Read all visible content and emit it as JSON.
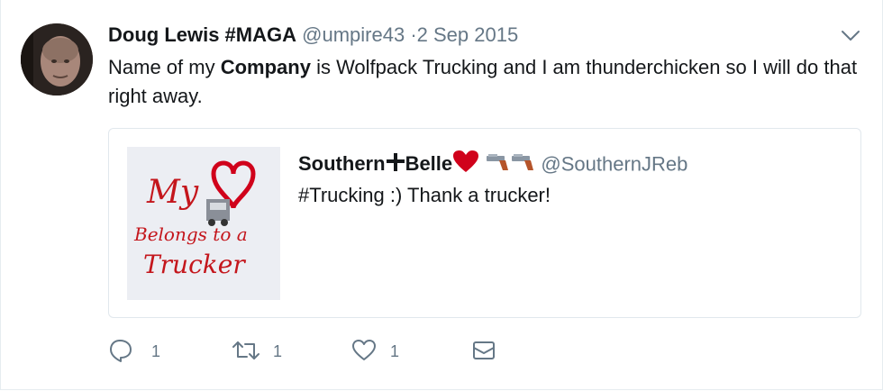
{
  "tweet": {
    "author_name": "Doug Lewis #MAGA",
    "handle": "@umpire43",
    "separator": "·",
    "date": "2 Sep 2015",
    "text_before": "Name of my ",
    "text_bold": "Company",
    "text_after": " is Wolfpack Trucking and I am thunderchicken so I will do that right away."
  },
  "quoted_tweet": {
    "name_part1": "Southern",
    "name_part2": "Belle",
    "handle": "@SouthernJReb",
    "text": "#Trucking :) Thank a trucker!",
    "image_text": {
      "line1": "My",
      "line2": "Belongs to a",
      "line3": "Trucker"
    }
  },
  "actions": {
    "reply_count": "1",
    "retweet_count": "1",
    "like_count": "1"
  },
  "colors": {
    "secondary_text": "#657786",
    "border": "#e1e8ed",
    "heart_red": "#d0021b"
  },
  "icons": [
    "caret-down-icon",
    "heavy-cross-icon",
    "heart-emoji-icon",
    "pistol-icon",
    "reply-icon",
    "retweet-icon",
    "like-icon",
    "direct-message-icon"
  ]
}
